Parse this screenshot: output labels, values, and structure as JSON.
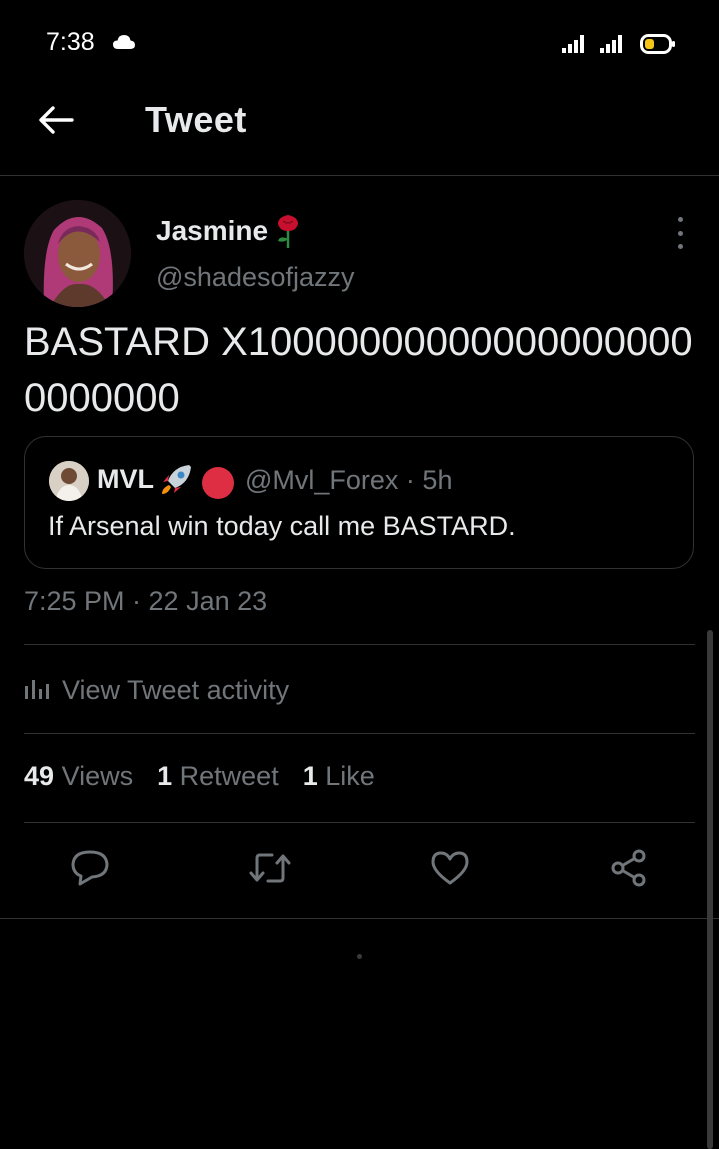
{
  "status_bar": {
    "time": "7:38",
    "icons": [
      "cloud-icon",
      "signal-icon",
      "signal-icon",
      "battery-icon"
    ]
  },
  "header": {
    "title": "Tweet",
    "back_icon": "arrow-left-icon"
  },
  "tweet": {
    "author": {
      "name": "Jasmine",
      "name_emoji": "rose-icon",
      "handle": "@shadesofjazzy"
    },
    "text": "BASTARD X100000000000000000000000000",
    "quote": {
      "name": "MVL",
      "name_emojis": [
        "rocket-icon",
        "red-circle-icon"
      ],
      "handle_time": "@Mvl_Forex · 5h",
      "text": "If Arsenal win today call me BASTARD."
    },
    "timestamp": "7:25 PM · 22 Jan 23",
    "activity_label": "View Tweet activity",
    "stats": [
      {
        "count": "49",
        "label": "Views"
      },
      {
        "count": "1",
        "label": "Retweet"
      },
      {
        "count": "1",
        "label": "Like"
      }
    ],
    "actions": [
      "reply-icon",
      "retweet-icon",
      "like-icon",
      "share-icon"
    ]
  },
  "colors": {
    "background": "#000000",
    "primary_text": "#e7e9ea",
    "secondary_text": "#71767b",
    "divider": "#2f3336",
    "battery_fill": "#f5c518"
  }
}
